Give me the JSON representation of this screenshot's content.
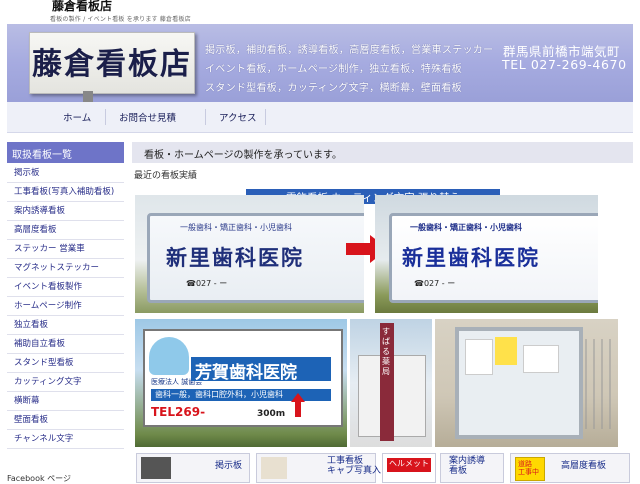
{
  "site": {
    "title": "藤倉看板店",
    "subtitle": "看板の製作 / イベント看板 を承ります 藤倉看板店"
  },
  "header": {
    "logo_text": "藤倉看板店",
    "services": [
      "掲示板，補助看板，誘導看板，高層度看板，営業車ステッカー",
      "イベント看板，ホームページ制作，独立看板，特殊看板",
      "スタンド型看板，カッティング文字，横断幕，壁面看板"
    ],
    "address": "群馬県前橋市端気町",
    "tel": "TEL 027-269-4670"
  },
  "nav": {
    "items": [
      "ホーム",
      "お問合せ見積",
      "アクセス"
    ]
  },
  "sidebar": {
    "heading": "取扱看板一覧",
    "items": [
      "掲示板",
      "工事看板(写真入補助看板)",
      "案内誘導看板",
      "高層度看板",
      "ステッカー 営業車",
      "マグネットステッカー",
      "イベント看板製作",
      "ホームページ制作",
      "独立看板",
      "補助自立看板",
      "スタンド型看板",
      "カッティング文字",
      "横断幕",
      "壁面看板",
      "チャンネル文字"
    ],
    "facebook_label": "Facebook  ページ"
  },
  "main": {
    "heading": "看板・ホームページの製作を承っています。",
    "latest_label": "最近の看板実績",
    "promo_banner": "電飾看板 カッティング文字  張り替え",
    "before_sign": {
      "line1": "一般歯科・矯正歯科・小児歯科",
      "name": "新里歯科医院",
      "tel": "☎027 - ー"
    },
    "after_sign": {
      "line1": "一般歯科・矯正歯科・小児歯科",
      "name": "新里歯科医院",
      "tel": "☎027 - ー"
    },
    "billboard": {
      "tagline": "医療法人 誠歯会",
      "name": "芳賀歯科医院",
      "services": "歯科一般，歯科口腔外科，小児歯科",
      "tel": "TEL269-",
      "distance": "300m"
    },
    "pillar_text": "すばる薬局",
    "bottom_thumbs": [
      {
        "label": "掲示板"
      },
      {
        "label": "工事看板\nキャブ写真入"
      },
      {
        "label": "ヘルメット"
      },
      {
        "label": "案内誘導\n看板"
      },
      {
        "label": "高層度看板"
      }
    ],
    "hard_hat_sign": "道路\n工事中"
  },
  "colors": {
    "accent": "#6e74c8",
    "header": "#a6abe0",
    "banner": "#2b5fb8",
    "arrow": "#d8141c"
  },
  "icons": {
    "arrow": "red-right-arrow-icon",
    "facebook": "facebook-icon"
  }
}
